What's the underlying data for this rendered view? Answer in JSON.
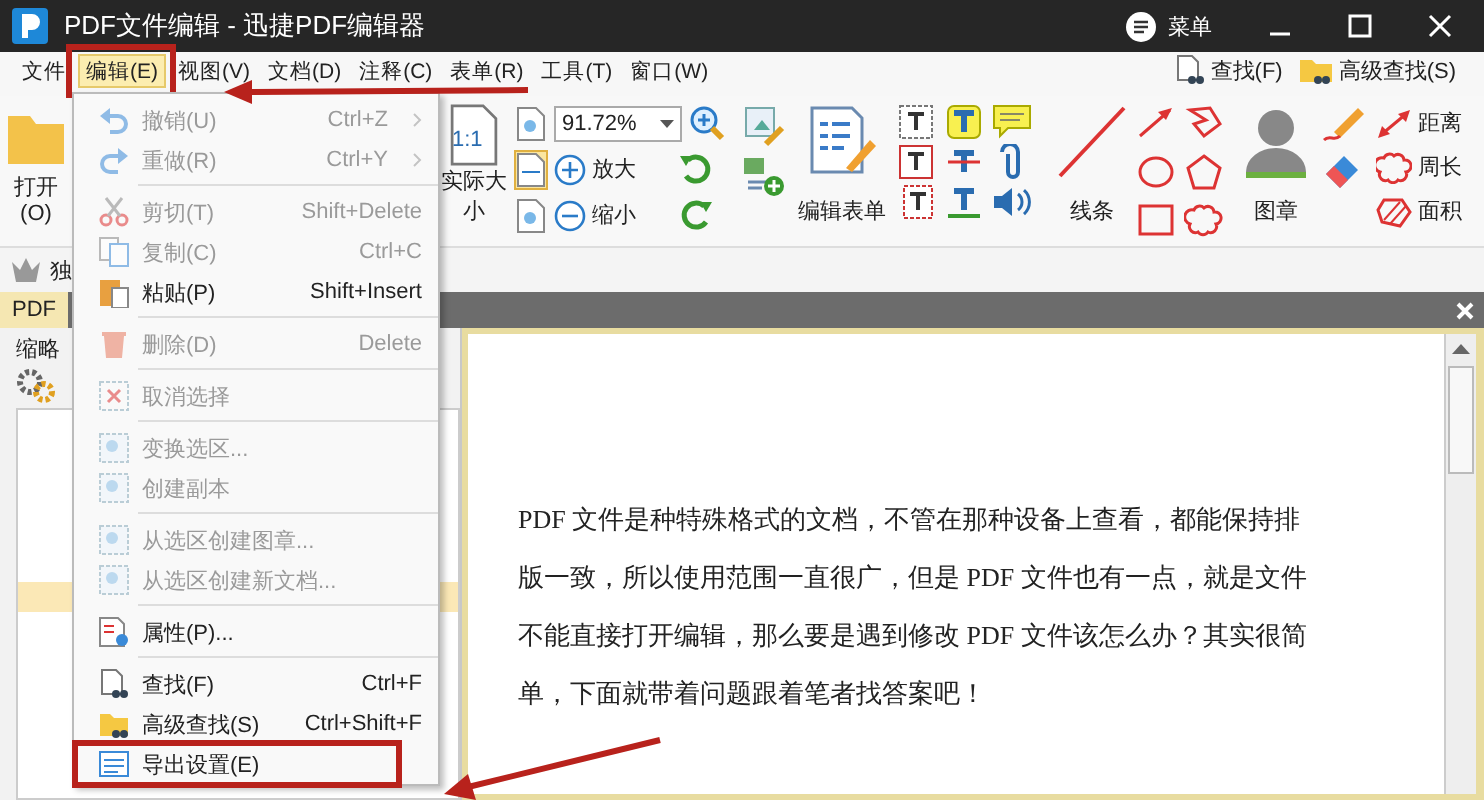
{
  "window": {
    "title": "PDF文件编辑 - 迅捷PDF编辑器",
    "menu_button": "菜单"
  },
  "menu_bar": {
    "items": [
      {
        "label": "文件",
        "selected": false
      },
      {
        "label": "编辑(E)",
        "selected": true
      },
      {
        "label": "视图(V)",
        "selected": false
      },
      {
        "label": "文档(D)",
        "selected": false
      },
      {
        "label": "注释(C)",
        "selected": false
      },
      {
        "label": "表单(R)",
        "selected": false
      },
      {
        "label": "工具(T)",
        "selected": false
      },
      {
        "label": "窗口(W)",
        "selected": false
      }
    ],
    "quick": [
      "查找(F)",
      "高级查找(S)"
    ]
  },
  "ribbon": {
    "open": "打开(O)",
    "actual_size_icon": "1:1",
    "actual_size": "实际大小",
    "zoom": {
      "value": "91.72%"
    },
    "zoom_in": "放大",
    "zoom_out": "缩小",
    "edit_form": "编辑表单",
    "lines": "线条",
    "stamp": "图章",
    "measure": [
      "距离",
      "周长",
      "面积"
    ]
  },
  "toolbar_row": {
    "label": "独"
  },
  "document_tab": {
    "label": "PDF"
  },
  "thumbnail_panel": {
    "title": "缩略"
  },
  "document": {
    "lines": [
      "PDF 文件是种特殊格式的文档，不管在那种设备上查看，都能保持排",
      "版一致，所以使用范围一直很广，但是 PDF 文件也有一点，就是文件",
      "不能直接打开编辑，那么要是遇到修改 PDF 文件该怎么办？其实很简",
      "单，下面就带着问题跟着笔者找答案吧！"
    ]
  },
  "edit_menu": {
    "items": [
      {
        "kind": "item",
        "label": "撤销(U)",
        "shortcut": "Ctrl+Z",
        "submenu": true,
        "disabled": true,
        "highlighted": false
      },
      {
        "kind": "item",
        "label": "重做(R)",
        "shortcut": "Ctrl+Y",
        "submenu": true,
        "disabled": true,
        "highlighted": false
      },
      {
        "kind": "separator"
      },
      {
        "kind": "item",
        "label": "剪切(T)",
        "shortcut": "Shift+Delete",
        "submenu": false,
        "disabled": true,
        "highlighted": false
      },
      {
        "kind": "item",
        "label": "复制(C)",
        "shortcut": "Ctrl+C",
        "submenu": false,
        "disabled": true,
        "highlighted": false
      },
      {
        "kind": "item",
        "label": "粘贴(P)",
        "shortcut": "Shift+Insert",
        "submenu": false,
        "disabled": false,
        "highlighted": false
      },
      {
        "kind": "separator"
      },
      {
        "kind": "item",
        "label": "删除(D)",
        "shortcut": "Delete",
        "submenu": false,
        "disabled": true,
        "highlighted": false
      },
      {
        "kind": "separator"
      },
      {
        "kind": "item",
        "label": "取消选择",
        "submenu": false,
        "disabled": true,
        "highlighted": false
      },
      {
        "kind": "separator"
      },
      {
        "kind": "item",
        "label": "变换选区...",
        "submenu": false,
        "disabled": true,
        "highlighted": false
      },
      {
        "kind": "item",
        "label": "创建副本",
        "submenu": false,
        "disabled": true,
        "highlighted": false
      },
      {
        "kind": "separator"
      },
      {
        "kind": "item",
        "label": "从选区创建图章...",
        "submenu": false,
        "disabled": true,
        "highlighted": false
      },
      {
        "kind": "item",
        "label": "从选区创建新文档...",
        "submenu": false,
        "disabled": true,
        "highlighted": false
      },
      {
        "kind": "separator"
      },
      {
        "kind": "item",
        "label": "属性(P)...",
        "submenu": false,
        "disabled": false,
        "highlighted": false
      },
      {
        "kind": "separator"
      },
      {
        "kind": "item",
        "label": "查找(F)",
        "shortcut": "Ctrl+F",
        "submenu": false,
        "disabled": false,
        "highlighted": false
      },
      {
        "kind": "item",
        "label": "高级查找(S)",
        "shortcut": "Ctrl+Shift+F",
        "submenu": false,
        "disabled": false,
        "highlighted": false
      },
      {
        "kind": "item",
        "label": "导出设置(E)",
        "submenu": false,
        "disabled": false,
        "highlighted": true
      }
    ]
  }
}
